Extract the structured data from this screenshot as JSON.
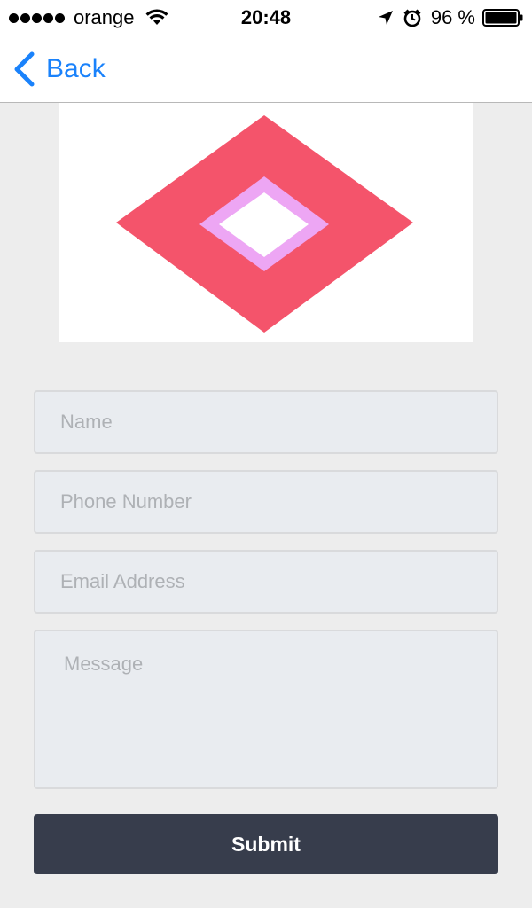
{
  "status_bar": {
    "carrier": "orange",
    "time": "20:48",
    "battery": "96 %",
    "icons": [
      "signal-dots-icon",
      "wifi-icon",
      "location-arrow-icon",
      "alarm-icon",
      "battery-icon"
    ]
  },
  "nav": {
    "back_label": "Back",
    "accent_color": "#1a82fb"
  },
  "logo": {
    "description_colors": {
      "outer": "#f4546b",
      "inner": "#eda6f4",
      "center": "#ffffff"
    }
  },
  "form": {
    "name_placeholder": "Name",
    "phone_placeholder": "Phone Number",
    "email_placeholder": "Email Address",
    "message_placeholder": "Message",
    "submit_label": "Submit",
    "submit_color": "#373d4c"
  }
}
